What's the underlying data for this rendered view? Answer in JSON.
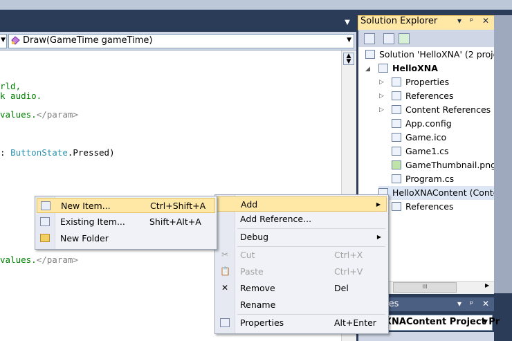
{
  "editor": {
    "method_combo": "Draw(GameTime gameTime)",
    "code_lines": [
      {
        "text": "rld,",
        "cls": "c-green"
      },
      {
        "text": "k audio.",
        "cls": "c-green"
      },
      {
        "text": "values.",
        "cls": "c-green",
        "tail": "</param>"
      },
      {
        "text": ": ",
        "cls": "",
        "type": "ButtonState",
        "rest": ".Pressed)"
      },
      {
        "text": "values.",
        "cls": "c-green",
        "tail": "</param>"
      }
    ]
  },
  "solution_explorer": {
    "title": "Solution Explorer",
    "title_buttons": [
      "▾",
      "ᵖ",
      "✕"
    ],
    "nodes": [
      {
        "label": "Solution 'HelloXNA' (2 proje",
        "icon": "solution-icon"
      },
      {
        "label": "HelloXNA",
        "icon": "project-icon",
        "bold": true
      },
      {
        "label": "Properties",
        "icon": "properties-folder-icon"
      },
      {
        "label": "References",
        "icon": "references-folder-icon"
      },
      {
        "label": "Content References",
        "icon": "content-references-icon"
      },
      {
        "label": "App.config",
        "icon": "config-file-icon"
      },
      {
        "label": "Game.ico",
        "icon": "icon-file-icon"
      },
      {
        "label": "Game1.cs",
        "icon": "cs-file-icon"
      },
      {
        "label": "GameThumbnail.png",
        "icon": "image-file-icon"
      },
      {
        "label": "Program.cs",
        "icon": "cs-file-icon"
      },
      {
        "label": "HelloXNAContent (Conte",
        "icon": "content-project-icon"
      },
      {
        "label": "References",
        "icon": "references-folder-icon"
      }
    ]
  },
  "properties_panel": {
    "title": "ies",
    "combo": "XNAContent  Project Pr"
  },
  "context_menu": {
    "items": [
      {
        "label": "Add",
        "shortcut": "",
        "submenu": true,
        "highlighted": true
      },
      {
        "label": "Add Reference...",
        "shortcut": ""
      },
      {
        "label": "Debug",
        "shortcut": "",
        "submenu": true
      },
      {
        "label": "Cut",
        "shortcut": "Ctrl+X",
        "disabled": true,
        "icon": "scissors-icon"
      },
      {
        "label": "Paste",
        "shortcut": "Ctrl+V",
        "disabled": true,
        "icon": "paste-icon"
      },
      {
        "label": "Remove",
        "shortcut": "Del",
        "icon": "remove-x-icon"
      },
      {
        "label": "Rename",
        "shortcut": ""
      },
      {
        "label": "Properties",
        "shortcut": "Alt+Enter",
        "icon": "properties-icon"
      }
    ]
  },
  "add_submenu": {
    "items": [
      {
        "label": "New Item...",
        "shortcut": "Ctrl+Shift+A",
        "highlighted": true,
        "icon": "new-item-icon"
      },
      {
        "label": "Existing Item...",
        "shortcut": "Shift+Alt+A",
        "icon": "existing-item-icon"
      },
      {
        "label": "New Folder",
        "shortcut": "",
        "icon": "folder-icon"
      }
    ]
  },
  "colors": {
    "highlight": "#ffe8a6",
    "chrome_dark": "#2b3c59",
    "toolbar": "#cfd6e5"
  }
}
